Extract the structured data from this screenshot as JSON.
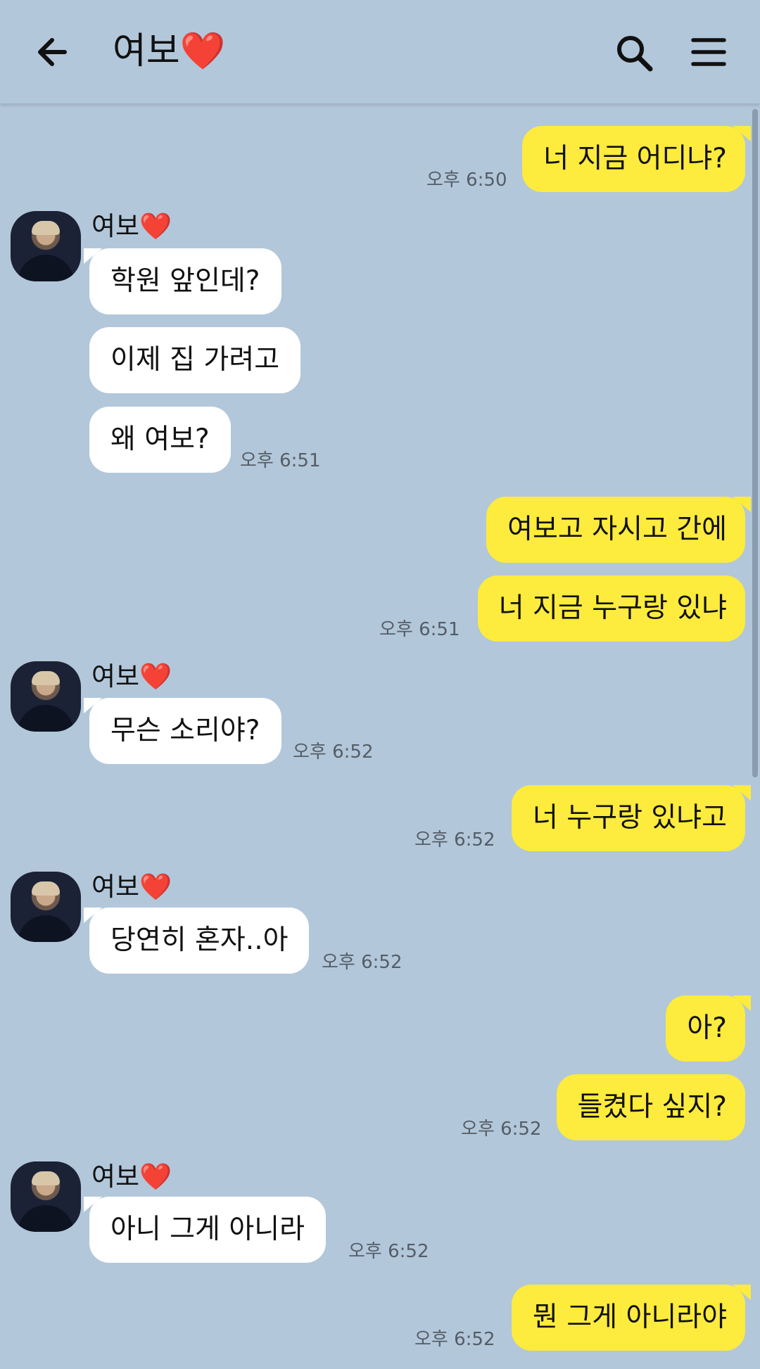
{
  "header": {
    "title": "여보",
    "title_emoji": "❤️",
    "back_icon": "arrow-left-icon",
    "search_icon": "search-icon",
    "menu_icon": "hamburger-menu-icon"
  },
  "colors": {
    "background": "#b2c7da",
    "my_bubble": "#fdeb3d",
    "their_bubble": "#ffffff",
    "heart": "#e41e2b"
  },
  "messages": [
    {
      "from": "me",
      "text": "너 지금 어디냐?",
      "time": "오후 6:50"
    },
    {
      "from": "them",
      "sender": "여보",
      "text": "학원 앞인데?"
    },
    {
      "from": "them",
      "text": "이제 집 가려고"
    },
    {
      "from": "them",
      "text": "왜 여보?",
      "time": "오후 6:51"
    },
    {
      "from": "me",
      "text": "여보고 자시고 간에"
    },
    {
      "from": "me",
      "text": "너 지금 누구랑 있냐",
      "time": "오후 6:51"
    },
    {
      "from": "them",
      "sender": "여보",
      "text": "무슨 소리야?",
      "time": "오후 6:52"
    },
    {
      "from": "me",
      "text": "너 누구랑 있냐고",
      "time": "오후 6:52"
    },
    {
      "from": "them",
      "sender": "여보",
      "text": "당연히 혼자..아",
      "time": "오후 6:52"
    },
    {
      "from": "me",
      "text": "아?"
    },
    {
      "from": "me",
      "text": "들켰다 싶지?",
      "time": "오후 6:52"
    },
    {
      "from": "them",
      "sender": "여보",
      "text": "아니 그게 아니라",
      "time": "오후 6:52"
    },
    {
      "from": "me",
      "text": "뭔 그게 아니라야",
      "time": "오후 6:52"
    }
  ]
}
